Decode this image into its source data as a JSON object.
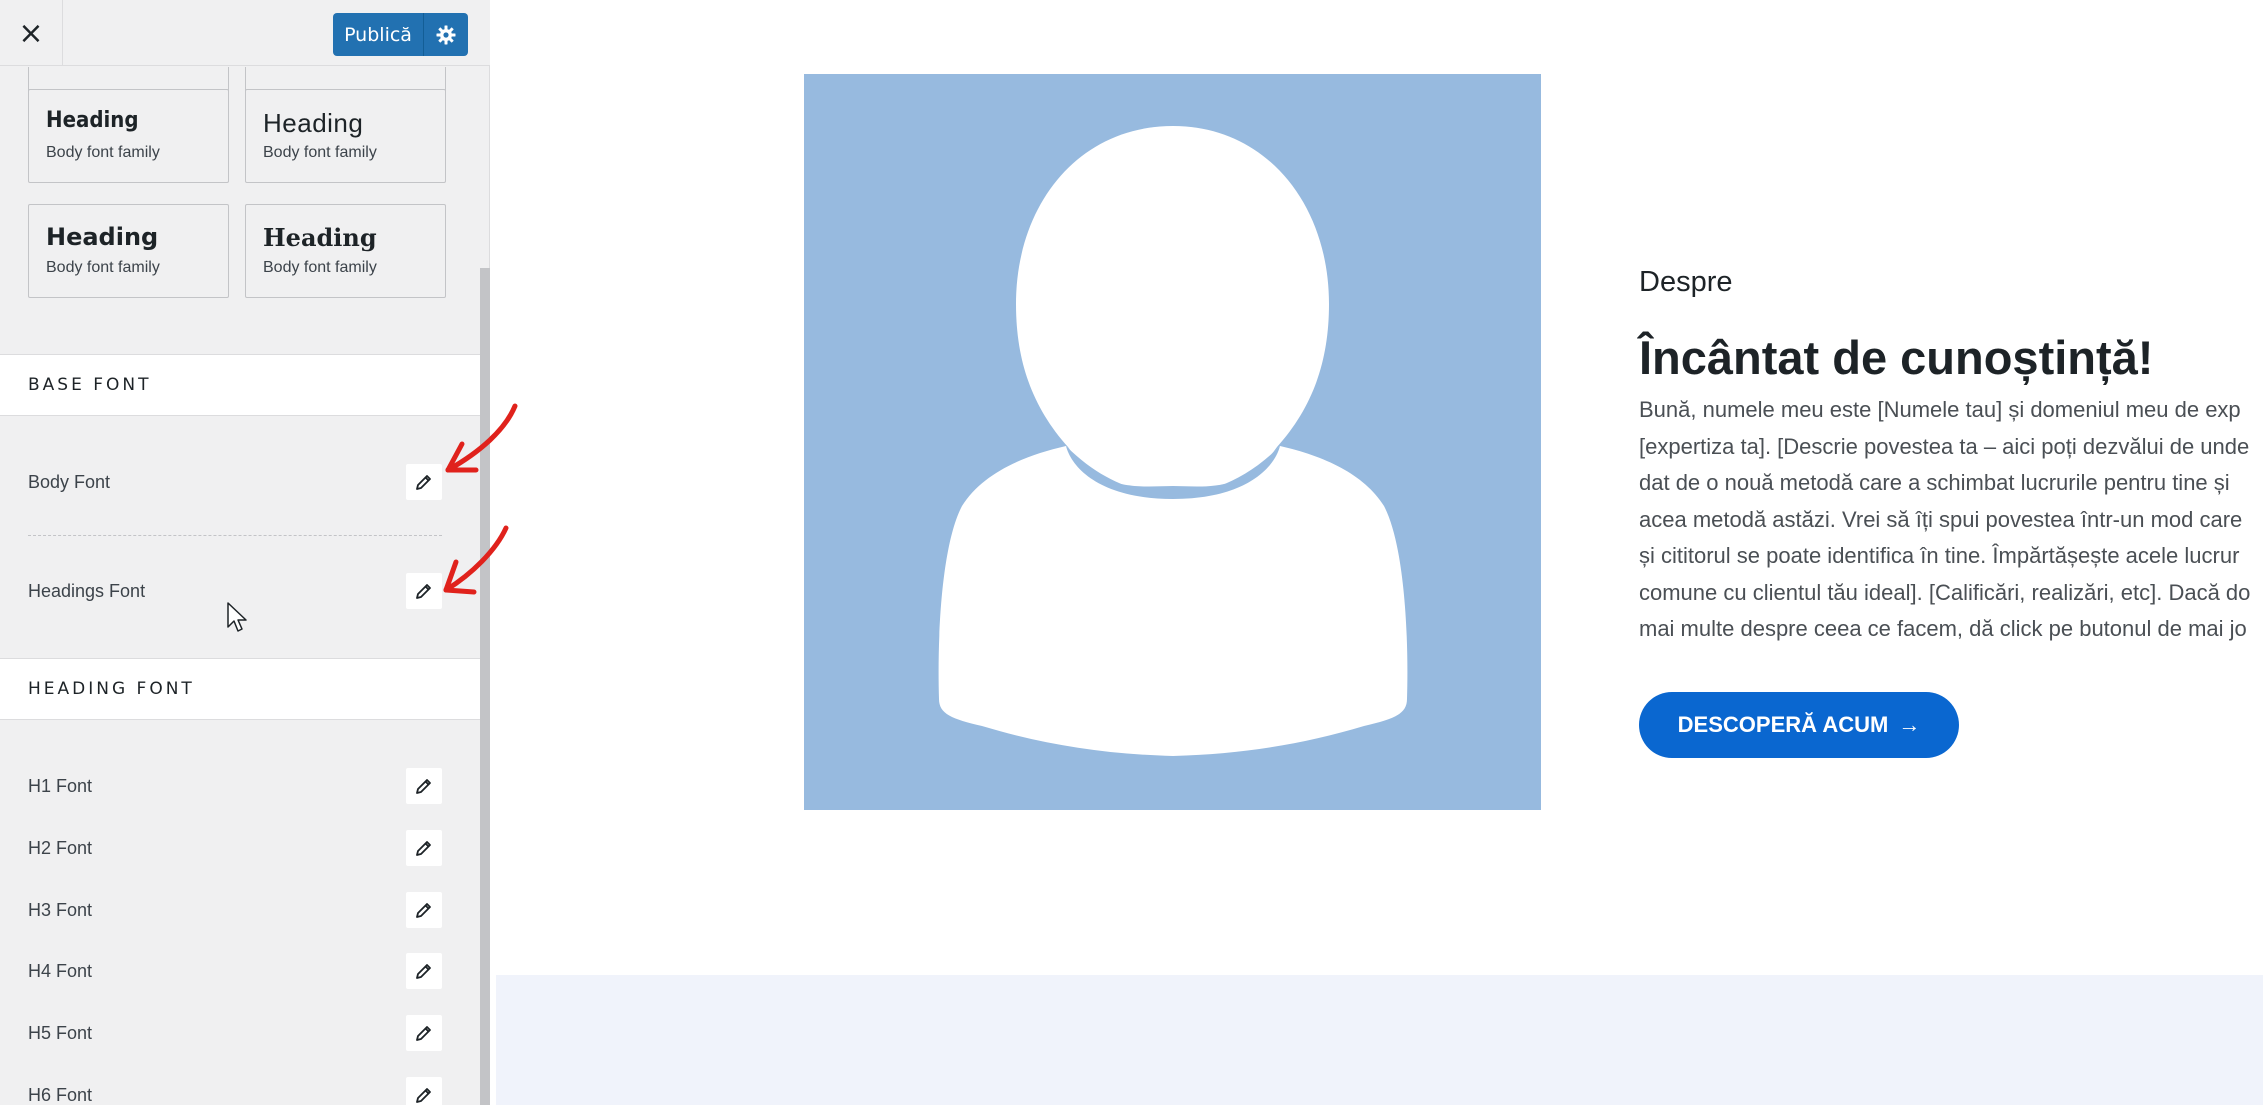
{
  "topbar": {
    "close_icon": "×",
    "publish_label": "Publică",
    "settings_icon": "gear-icon"
  },
  "presets": [
    {
      "heading": "Heading",
      "body": "Body font family"
    },
    {
      "heading": "Heading",
      "body": "Body font family"
    },
    {
      "heading": "Heading",
      "body": "Body font family"
    },
    {
      "heading": "Heading",
      "body": "Body font family"
    }
  ],
  "base_font": {
    "title": "BASE FONT",
    "rows": [
      {
        "label": "Body Font"
      },
      {
        "label": "Headings Font"
      }
    ]
  },
  "heading_font": {
    "title": "HEADING FONT",
    "rows": [
      {
        "label": "H1 Font"
      },
      {
        "label": "H2 Font"
      },
      {
        "label": "H3 Font"
      },
      {
        "label": "H4 Font"
      },
      {
        "label": "H5 Font"
      },
      {
        "label": "H6 Font"
      }
    ]
  },
  "preview": {
    "about_label": "Despre",
    "about_title": "Încântat de cunoștință!",
    "about_lines": [
      "Bună, numele meu este [Numele tau] și domeniul meu de exp",
      "[expertiza ta]. [Descrie povestea ta – aici poți dezvălui de unde",
      "dat de o nouă metodă care a schimbat lucrurile pentru tine și",
      "acea metodă astăzi. Vrei să îți spui povestea într-un mod care",
      "și cititorul se poate identifica în tine. Împărtășește acele lucrur",
      "comune cu clientul tău ideal]. [Calificări, realizări, etc]. Dacă do",
      "mai multe despre ceea ce facem, dă click pe butonul de mai jo"
    ],
    "cta_label": "DESCOPERĂ ACUM",
    "cta_arrow": "→"
  },
  "colors": {
    "primary": "#2271b1",
    "cta": "#0a67d0",
    "avatar_bg": "#97badf",
    "annotation": "#e0221c"
  }
}
